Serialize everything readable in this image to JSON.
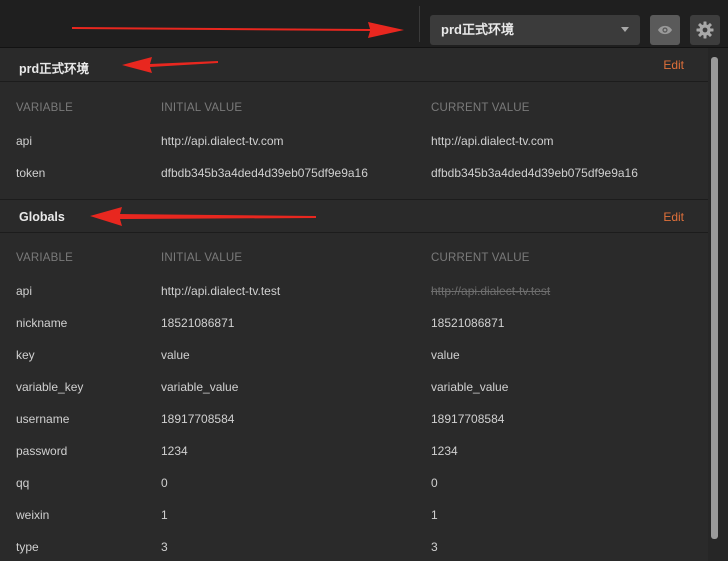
{
  "env_selector": {
    "value": "prd正式环境"
  },
  "icons": {
    "eye": "eye-icon",
    "settings": "gear-icon",
    "dropdown": "chevron-down-icon"
  },
  "columns": {
    "variable": "VARIABLE",
    "initial": "INITIAL VALUE",
    "current": "CURRENT VALUE"
  },
  "environment": {
    "name": "prd正式环境",
    "edit_label": "Edit",
    "rows": [
      {
        "variable": "api",
        "initial": "http://api.dialect-tv.com",
        "current": "http://api.dialect-tv.com"
      },
      {
        "variable": "token",
        "initial": "dfbdb345b3a4ded4d39eb075df9e9a16",
        "current": "dfbdb345b3a4ded4d39eb075df9e9a16"
      }
    ]
  },
  "globals": {
    "name": "Globals",
    "edit_label": "Edit",
    "rows": [
      {
        "variable": "api",
        "initial": "http://api.dialect-tv.test",
        "current": "http://api.dialect-tv.test"
      },
      {
        "variable": "nickname",
        "initial": "18521086871",
        "current": "18521086871"
      },
      {
        "variable": "key",
        "initial": "value",
        "current": "value"
      },
      {
        "variable": "variable_key",
        "initial": "variable_value",
        "current": "variable_value"
      },
      {
        "variable": "username",
        "initial": "18917708584",
        "current": "18917708584"
      },
      {
        "variable": "password",
        "initial": "1234",
        "current": "1234"
      },
      {
        "variable": "qq",
        "initial": "0",
        "current": "0"
      },
      {
        "variable": "weixin",
        "initial": "1",
        "current": "1"
      },
      {
        "variable": "type",
        "initial": "3",
        "current": "3"
      }
    ]
  },
  "colors": {
    "edit_link": "#e0703a",
    "annotation_arrow": "#e8271f",
    "background": "#2a2a2a"
  }
}
